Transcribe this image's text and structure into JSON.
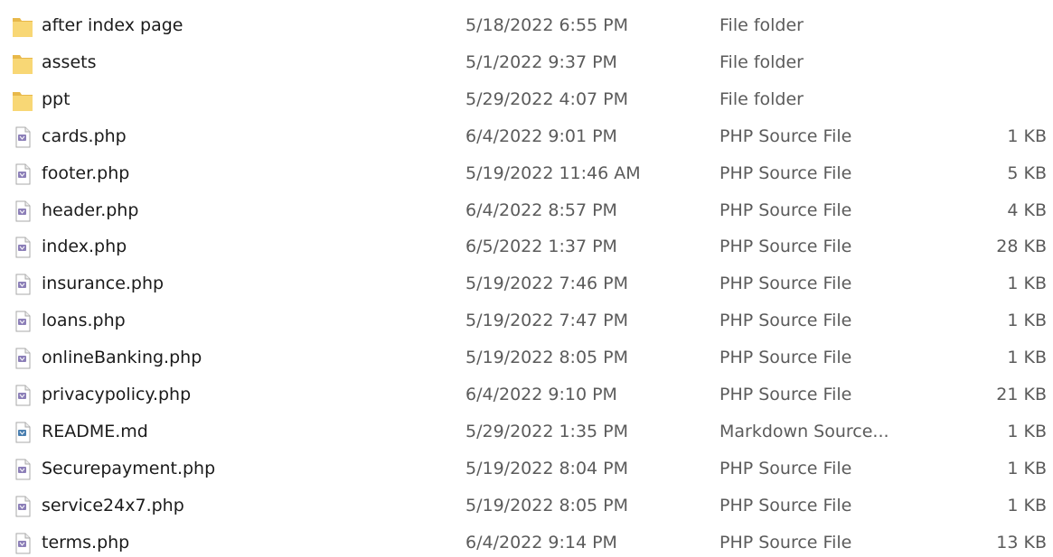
{
  "files": [
    {
      "name": "after index page",
      "modified": "5/18/2022 6:55 PM",
      "type": "File folder",
      "size": "",
      "icon": "folder-icon"
    },
    {
      "name": "assets",
      "modified": "5/1/2022 9:37 PM",
      "type": "File folder",
      "size": "",
      "icon": "folder-icon"
    },
    {
      "name": "ppt",
      "modified": "5/29/2022 4:07 PM",
      "type": "File folder",
      "size": "",
      "icon": "folder-icon"
    },
    {
      "name": "cards.php",
      "modified": "6/4/2022 9:01 PM",
      "type": "PHP Source File",
      "size": "1 KB",
      "icon": "php-file-icon"
    },
    {
      "name": "footer.php",
      "modified": "5/19/2022 11:46 AM",
      "type": "PHP Source File",
      "size": "5 KB",
      "icon": "php-file-icon"
    },
    {
      "name": "header.php",
      "modified": "6/4/2022 8:57 PM",
      "type": "PHP Source File",
      "size": "4 KB",
      "icon": "php-file-icon"
    },
    {
      "name": "index.php",
      "modified": "6/5/2022 1:37 PM",
      "type": "PHP Source File",
      "size": "28 KB",
      "icon": "php-file-icon"
    },
    {
      "name": "insurance.php",
      "modified": "5/19/2022 7:46 PM",
      "type": "PHP Source File",
      "size": "1 KB",
      "icon": "php-file-icon"
    },
    {
      "name": "loans.php",
      "modified": "5/19/2022 7:47 PM",
      "type": "PHP Source File",
      "size": "1 KB",
      "icon": "php-file-icon"
    },
    {
      "name": "onlineBanking.php",
      "modified": "5/19/2022 8:05 PM",
      "type": "PHP Source File",
      "size": "1 KB",
      "icon": "php-file-icon"
    },
    {
      "name": "privacypolicy.php",
      "modified": "6/4/2022 9:10 PM",
      "type": "PHP Source File",
      "size": "21 KB",
      "icon": "php-file-icon"
    },
    {
      "name": "README.md",
      "modified": "5/29/2022 1:35 PM",
      "type": "Markdown Source...",
      "size": "1 KB",
      "icon": "markdown-file-icon"
    },
    {
      "name": "Securepayment.php",
      "modified": "5/19/2022 8:04 PM",
      "type": "PHP Source File",
      "size": "1 KB",
      "icon": "php-file-icon"
    },
    {
      "name": "service24x7.php",
      "modified": "5/19/2022 8:05 PM",
      "type": "PHP Source File",
      "size": "1 KB",
      "icon": "php-file-icon"
    },
    {
      "name": "terms.php",
      "modified": "6/4/2022 9:14 PM",
      "type": "PHP Source File",
      "size": "13 KB",
      "icon": "php-file-icon"
    }
  ],
  "colors": {
    "folder": "#f8d775",
    "folder_dark": "#e8b84a",
    "php_badge": "#8c7fb8",
    "markdown_badge": "#4a7fb0",
    "text": "#1b1b1b",
    "meta_text": "#5b5b5b"
  }
}
